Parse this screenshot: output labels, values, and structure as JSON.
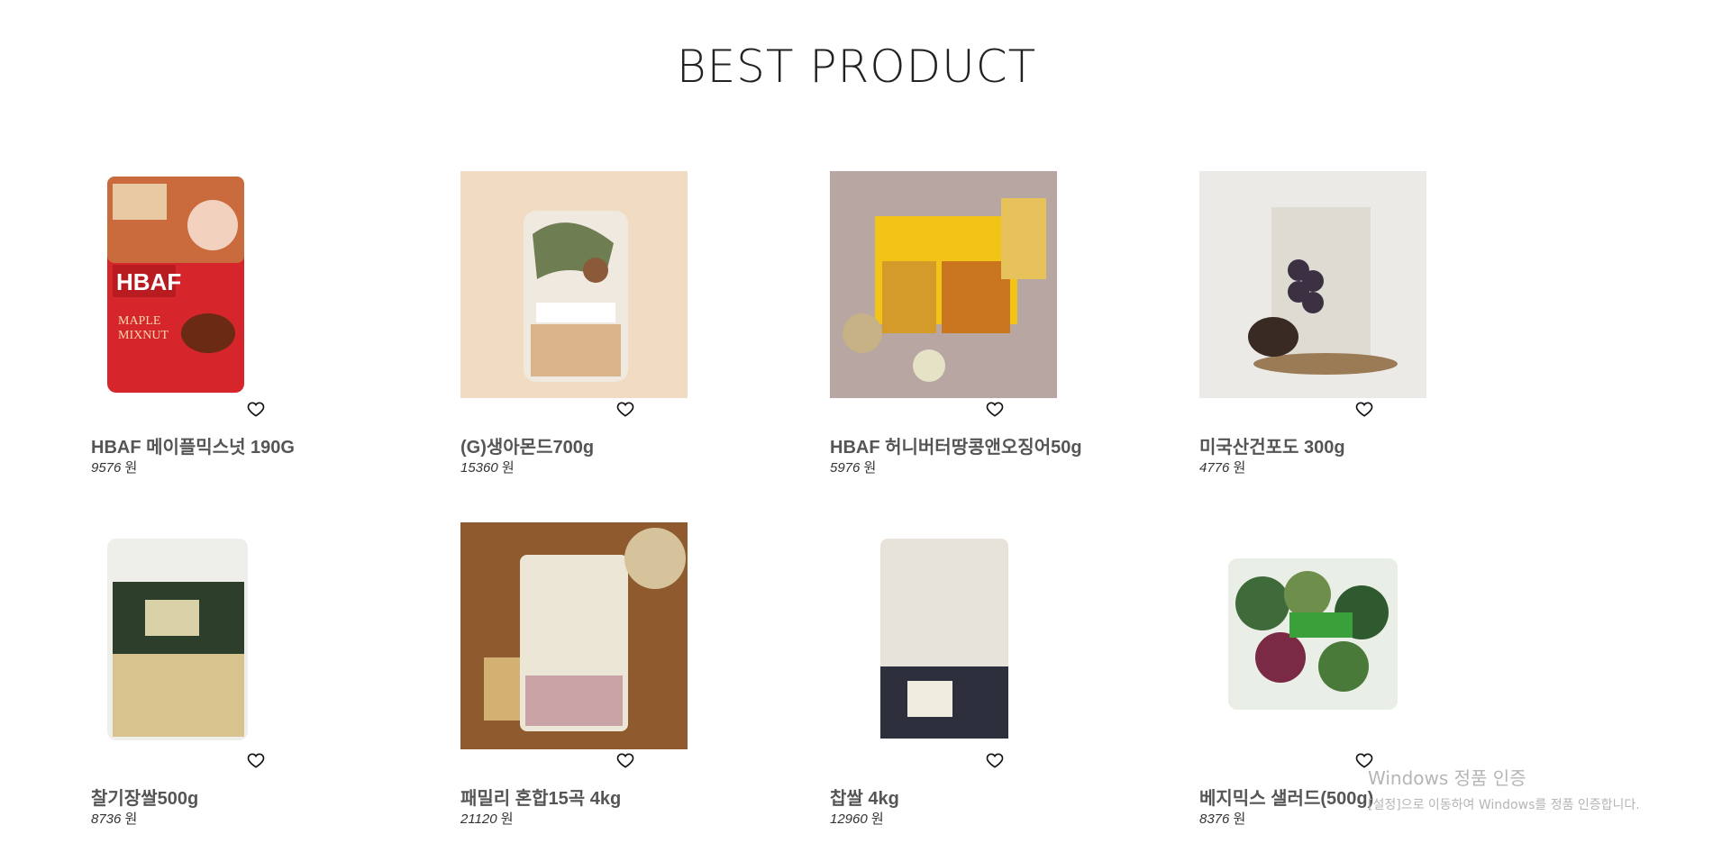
{
  "section": {
    "title": "BEST PRODUCT"
  },
  "currency": "원",
  "products": [
    {
      "name": "HBAF 메이플믹스넛 190G",
      "price": "9576",
      "image": "nut-pack-red"
    },
    {
      "name": "(G)생아몬드700g",
      "price": "15360",
      "image": "almond-bag"
    },
    {
      "name": "HBAF 허니버터땅콩앤오징어50g",
      "price": "5976",
      "image": "snack-pack-yellow"
    },
    {
      "name": "미국산건포도 300g",
      "price": "4776",
      "image": "raisin-pack"
    },
    {
      "name": "찰기장쌀500g",
      "price": "8736",
      "image": "millet-bag"
    },
    {
      "name": "패밀리 혼합15곡 4kg",
      "price": "21120",
      "image": "grain-bag-wood"
    },
    {
      "name": "찹쌀 4kg",
      "price": "12960",
      "image": "rice-bag"
    },
    {
      "name": "베지믹스 샐러드(500g)",
      "price": "8376",
      "image": "salad-bag"
    }
  ],
  "watermark": {
    "title": "Windows 정품 인증",
    "subtitle": "[설정]으로 이동하여 Windows를 정품 인증합니다."
  }
}
